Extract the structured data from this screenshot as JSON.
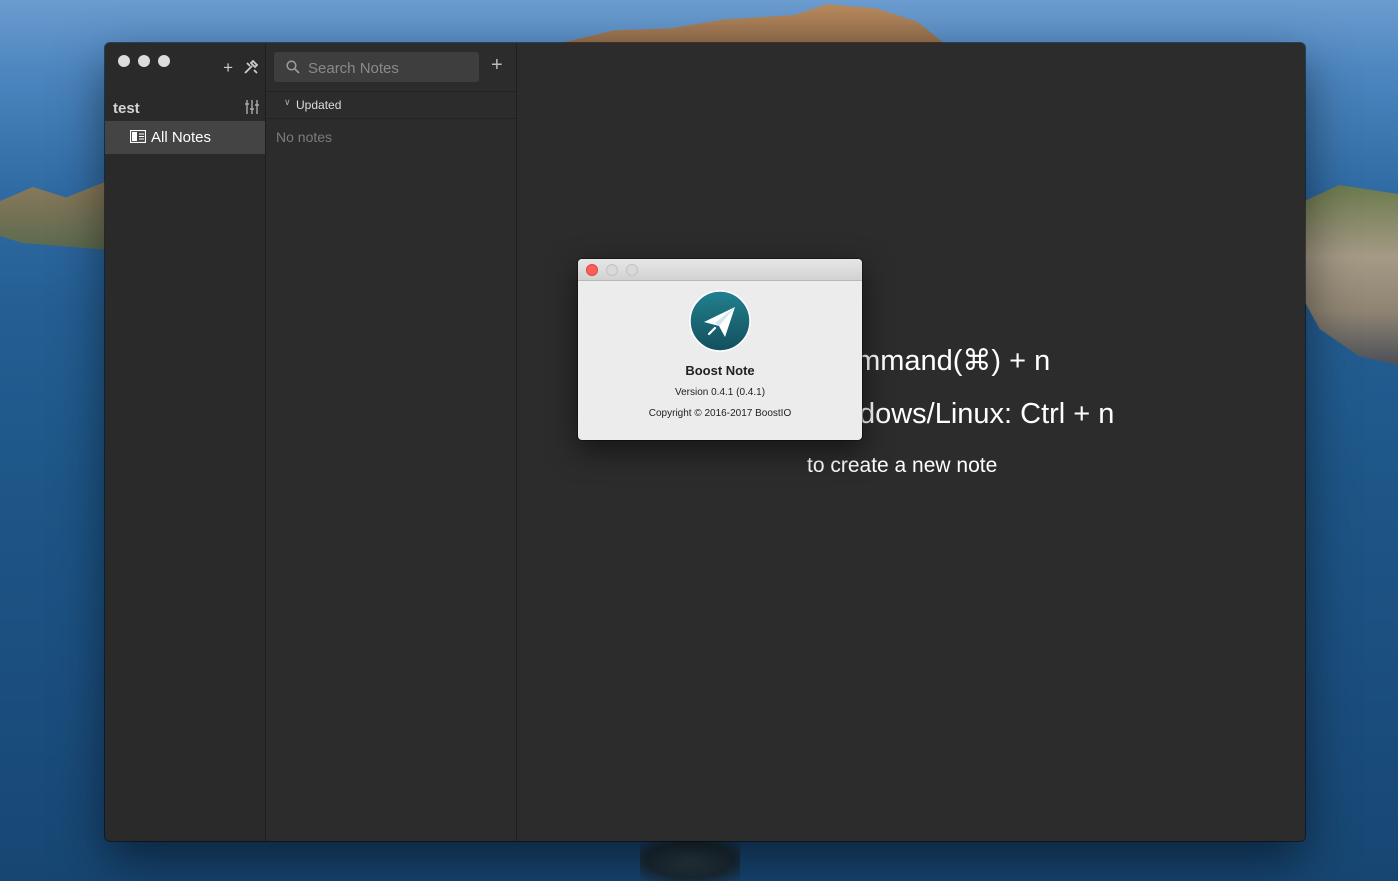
{
  "sidebar": {
    "storage_name": "test",
    "all_notes_label": "All Notes"
  },
  "note_list": {
    "search_placeholder": "Search Notes",
    "sort_label": "Updated",
    "empty_message": "No notes"
  },
  "detail": {
    "hint_mac": "Command(⌘) + n",
    "hint_win": "Windows/Linux: Ctrl + n",
    "hint_create": "to create a new note"
  },
  "about_dialog": {
    "app_name": "Boost Note",
    "version": "Version 0.4.1 (0.4.1)",
    "copyright": "Copyright © 2016-2017 BoostIO"
  },
  "colors": {
    "app_bg": "#2c2c2c",
    "sidebar_active": "#444444",
    "logo_teal": "#1d6b7a",
    "dialog_bg": "#ececec"
  }
}
